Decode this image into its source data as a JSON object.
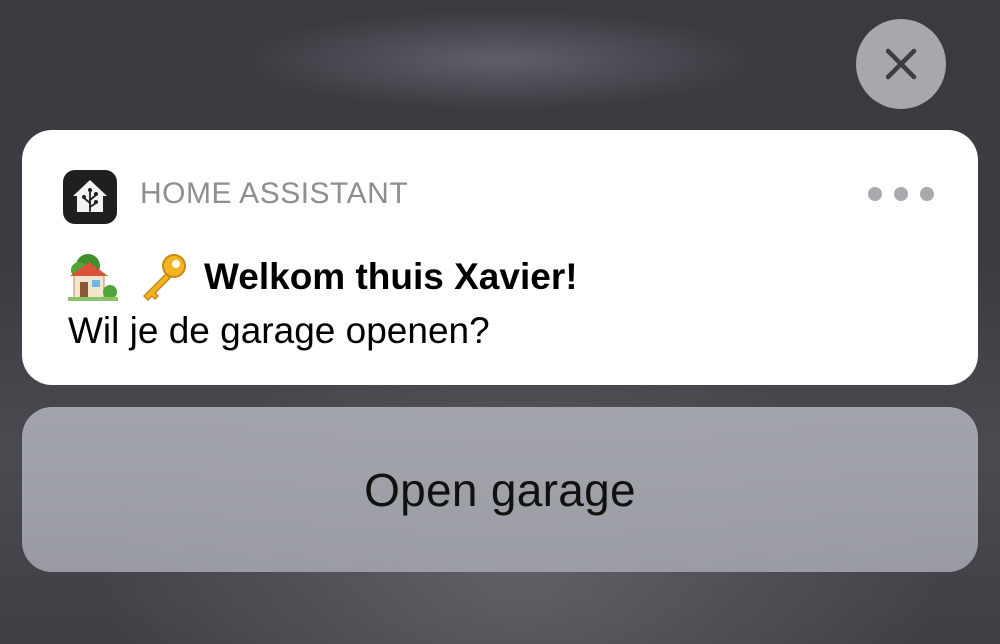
{
  "notification": {
    "app_name": "HOME ASSISTANT",
    "app_icon": "home-assistant-icon",
    "title_emojis": [
      "house-with-garden-emoji",
      "key-emoji"
    ],
    "title": "Welkom thuis Xavier!",
    "body": "Wil je de garage openen?",
    "more_icon": "more-dots-icon"
  },
  "actions": {
    "close_icon": "close-icon",
    "open_garage_label": "Open garage"
  },
  "colors": {
    "card_background": "#ffffff",
    "action_background": "#a7a9b0",
    "close_button": "#a7a8ad",
    "app_name_text": "#8e8e93"
  }
}
